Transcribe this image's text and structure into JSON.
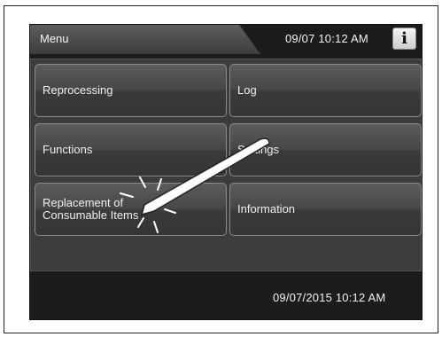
{
  "header": {
    "title": "Menu",
    "datetime": "09/07 10:12 AM",
    "info_icon_glyph": "i"
  },
  "menu": {
    "items": [
      {
        "label": "Reprocessing"
      },
      {
        "label": "Log"
      },
      {
        "label": "Functions"
      },
      {
        "label": "Settings"
      },
      {
        "label_line1": "Replacement of",
        "label_line2": "Consumable Items"
      },
      {
        "label": "Information"
      }
    ]
  },
  "footer": {
    "datetime": "09/07/2015 10:12 AM"
  },
  "icons": {
    "info": "info-icon",
    "stylus": "stylus-pointer-icon"
  },
  "colors": {
    "screen_bg": "#1c1c1c",
    "button_border": "#8a8a8a",
    "text": "#f0f0f0"
  }
}
